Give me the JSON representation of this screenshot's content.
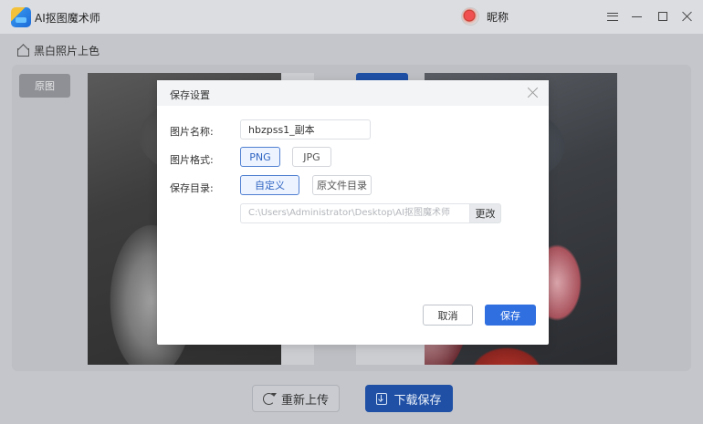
{
  "app": {
    "title": "AI抠图魔术师",
    "user_name": "昵称"
  },
  "breadcrumb": {
    "label": "黑白照片上色"
  },
  "workspace": {
    "original_tab": "原图"
  },
  "actions": {
    "reupload": "重新上传",
    "download_save": "下载保存"
  },
  "dialog": {
    "title": "保存设置",
    "name_label": "图片名称:",
    "name_value": "hbzpss1_副本",
    "format_label": "图片格式:",
    "formats": [
      "PNG",
      "JPG"
    ],
    "selected_format": "PNG",
    "dir_label": "保存目录:",
    "dir_options": [
      "自定义",
      "原文件目录"
    ],
    "selected_dir_option": "自定义",
    "path_value": "C:\\Users\\Administrator\\Desktop\\AI抠图魔术师",
    "change_button": "更改",
    "cancel_button": "取消",
    "save_button": "保存"
  },
  "colors": {
    "primary": "#2f6fe0",
    "primary_dark": "#1f50a5",
    "selected_bg": "#eef4ff"
  }
}
